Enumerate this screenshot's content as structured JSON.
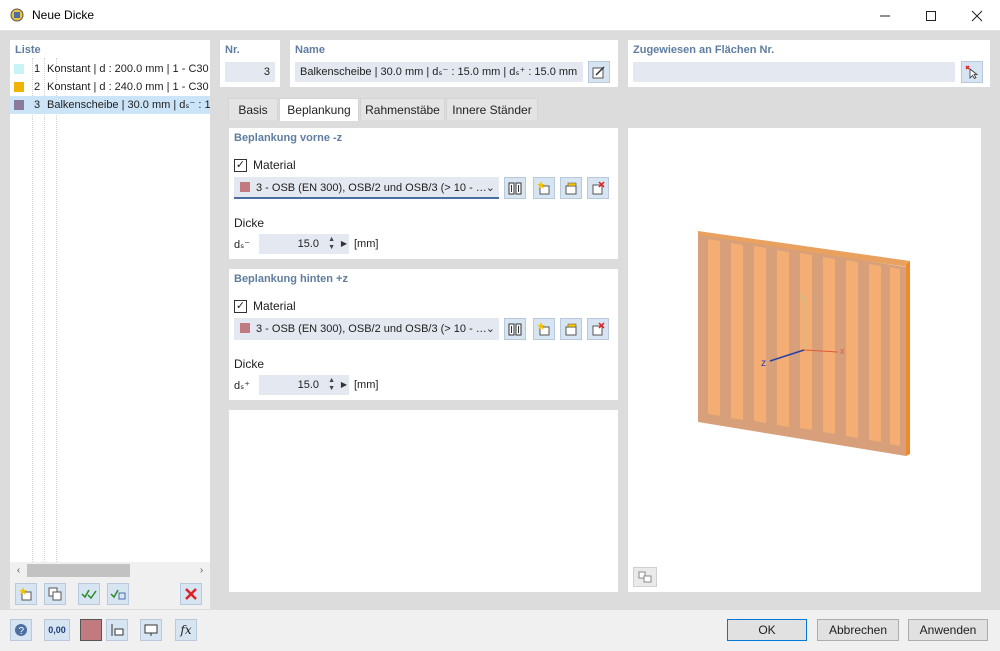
{
  "window": {
    "title": "Neue Dicke"
  },
  "list": {
    "header": "Liste",
    "items": [
      {
        "num": "1",
        "text": "Konstant | d : 200.0 mm | 1 - C30",
        "color": "#c8f4f8"
      },
      {
        "num": "2",
        "text": "Konstant | d : 240.0 mm | 1 - C30",
        "color": "#f0b400"
      },
      {
        "num": "3",
        "text": "Balkenscheibe | 30.0 mm | dₛ⁻ : 1",
        "color": "#8b7a9a"
      }
    ]
  },
  "nr": {
    "label": "Nr.",
    "value": "3"
  },
  "name": {
    "label": "Name",
    "value": "Balkenscheibe | 30.0 mm | dₛ⁻ : 15.0 mm | dₛ⁺ : 15.0 mm"
  },
  "assigned": {
    "label": "Zugewiesen an Flächen Nr.",
    "value": ""
  },
  "tabs": [
    "Basis",
    "Beplankung",
    "Rahmenstäbe",
    "Innere Ständer"
  ],
  "front": {
    "title": "Beplankung vorne -z",
    "material_label": "Material",
    "material_value": "3 - OSB (EN 300), OSB/2 und OSB/3 (> 10 - …",
    "material_color": "#c07a80",
    "thickness_label": "Dicke",
    "ds_label": "dₛ⁻",
    "ds_value": "15.0",
    "unit": "[mm]"
  },
  "back": {
    "title": "Beplankung hinten +z",
    "material_label": "Material",
    "material_value": "3 - OSB (EN 300), OSB/2 und OSB/3 (> 10 - …",
    "material_color": "#c07a80",
    "thickness_label": "Dicke",
    "ds_label": "dₛ⁺",
    "ds_value": "15.0",
    "unit": "[mm]"
  },
  "preview": {
    "axis_x": "x",
    "axis_y": "y",
    "axis_z": "z"
  },
  "buttons": {
    "ok": "OK",
    "cancel": "Abbrechen",
    "apply": "Anwenden"
  },
  "bottom_tools": {
    "decimals": "0,00"
  },
  "colors": {
    "accent": "#0078d7",
    "header": "#5f7da0",
    "panel_orange": "#f2a25e",
    "frame_brown": "#d8a07a"
  }
}
